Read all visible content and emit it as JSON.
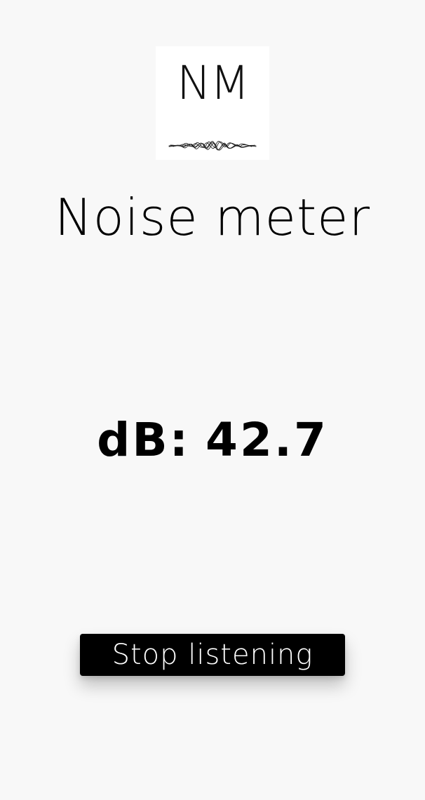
{
  "app": {
    "logo_text": "NM",
    "title": "Noise meter"
  },
  "meter": {
    "label": "dB:",
    "value": "42.7"
  },
  "controls": {
    "stop_label": "Stop listening"
  },
  "colors": {
    "background": "#f8f8f8",
    "text": "#000000",
    "button_bg": "#000000",
    "button_text": "#ffffff"
  }
}
